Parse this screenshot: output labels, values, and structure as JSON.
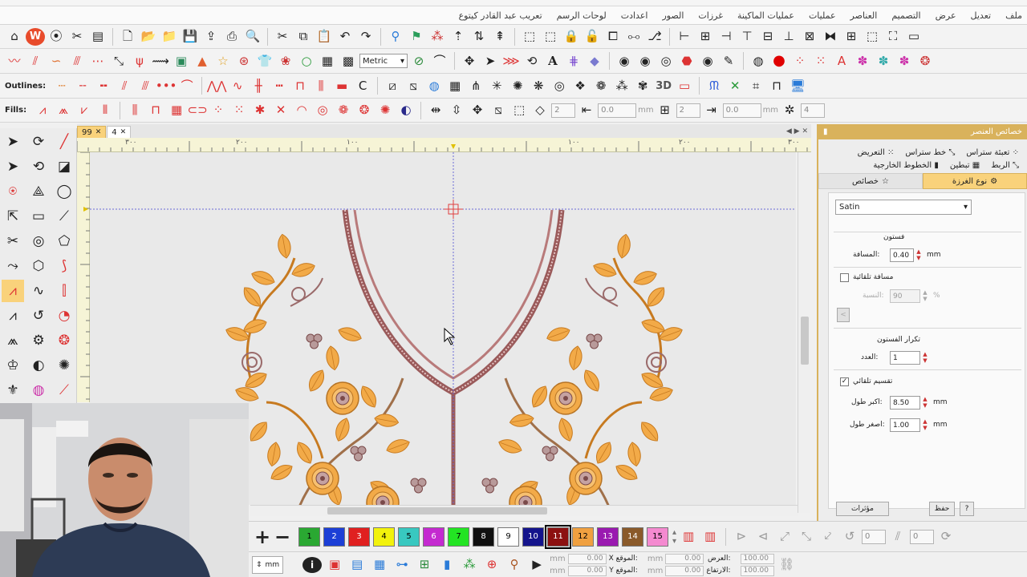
{
  "title_bar": {
    "text": "تعريب عبد القادر كيتوع"
  },
  "menu": [
    "ملف",
    "تعديل",
    "عرض",
    "التصميم",
    "العناصر",
    "عمليات",
    "عمليات الماكينة",
    "غرزات",
    "الصور",
    "اعدادت",
    "لوحات الرسم",
    "تعريب عبد القادر كيتوع"
  ],
  "toolbar3": {
    "label": "Outlines:",
    "btn_3d": "3D"
  },
  "toolbar4": {
    "label": "Fills:"
  },
  "toolbar2": {
    "units": "Metric"
  },
  "toolbar4_fields": {
    "spin_a": "2",
    "field_a": "0.0",
    "unit_a": "mm",
    "spin_b": "2",
    "field_b": "0.0",
    "unit_b": "mm",
    "spin_c": "4"
  },
  "doc_tabs": [
    {
      "label": "99"
    },
    {
      "label": "4"
    }
  ],
  "ruler": {
    "labels": [
      "٣٠٠",
      "٢٠٠",
      "١٠٠",
      "١٠٠",
      "٢٠٠",
      "٣٠٠"
    ]
  },
  "right_panel": {
    "title": "خصائص العنصر",
    "tabs_row1": [
      "تعبئة ستراس",
      "خط ستراس",
      "التعريض"
    ],
    "tabs_row2": [
      "الربط",
      "تبطين",
      "الخطوط الخارجية"
    ],
    "subtabs": {
      "stitch_type": "نوع الغرزة",
      "properties": "خصائص"
    },
    "stitch_select": "Satin",
    "density_heading": "فستون",
    "density_label": ":المسافة",
    "density_value": "0.40",
    "density_unit": "mm",
    "auto_spacing_label": "مسافة تلقائية",
    "percent_label": ":النسبة",
    "percent_value": "90",
    "percent_unit": "%",
    "repeat_heading": "تكرار الفستون",
    "count_label": ":العدد",
    "count_value": "1",
    "auto_split_label": "تقسيم تلقائي",
    "max_length_label": ":اكبر طول",
    "max_length_value": "8.50",
    "max_length_unit": "mm",
    "min_length_label": ":اصغر طول",
    "min_length_value": "1.00",
    "min_length_unit": "mm",
    "btn_effects": "مؤثرات",
    "btn_save": "حفظ",
    "btn_help": "?"
  },
  "colors": {
    "accent": "#d9b25c",
    "swatches": [
      {
        "num": "1",
        "color": "#2aa832"
      },
      {
        "num": "2",
        "color": "#1c3fd6"
      },
      {
        "num": "3",
        "color": "#e02020"
      },
      {
        "num": "4",
        "color": "#f2f20c"
      },
      {
        "num": "5",
        "color": "#38c8c0"
      },
      {
        "num": "6",
        "color": "#c42ad0"
      },
      {
        "num": "7",
        "color": "#23e423"
      },
      {
        "num": "8",
        "color": "#101010"
      },
      {
        "num": "9",
        "color": "#ffffff"
      },
      {
        "num": "10",
        "color": "#14148c"
      },
      {
        "num": "11",
        "color": "#8c1010"
      },
      {
        "num": "12",
        "color": "#f0a040"
      },
      {
        "num": "13",
        "color": "#9a1ab0"
      },
      {
        "num": "14",
        "color": "#8a5a2a"
      },
      {
        "num": "15",
        "color": "#f48ad0"
      }
    ],
    "selected_swatch": "11"
  },
  "status": {
    "unit": "mm",
    "pos_x_label": ":الموقع X",
    "pos_y_label": ":الموقع Y",
    "pos_x": "0.00",
    "pos_y": "0.00",
    "width_label": ":العرض",
    "height_label": ":الارتفاع",
    "width": "0.00",
    "height": "0.00",
    "unit_mm": "mm",
    "scale_w": "100.00",
    "scale_h": "100.00",
    "rotate_a": "0",
    "rotate_b": "0"
  }
}
